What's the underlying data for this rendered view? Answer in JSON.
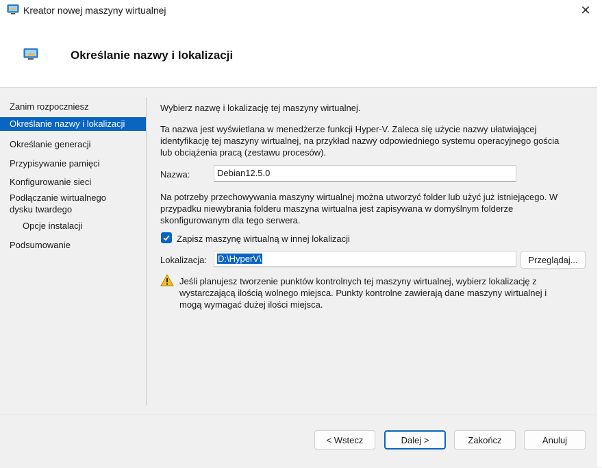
{
  "window": {
    "title": "Kreator nowej maszyny wirtualnej",
    "close_glyph": "✕"
  },
  "header": {
    "title": "Określanie nazwy i lokalizacji",
    "icon": "vm-monitor-icon"
  },
  "nav": {
    "items": [
      {
        "label": "Zanim rozpoczniesz"
      },
      {
        "label": "Określanie nazwy i lokalizacji"
      },
      {
        "label": "Określanie generacji"
      },
      {
        "label": "Przypisywanie pamięci"
      },
      {
        "label": "Konfigurowanie sieci"
      },
      {
        "label": "Podłączanie wirtualnego"
      },
      {
        "label": "dysku twardego"
      },
      {
        "label": "Opcje instalacji"
      },
      {
        "label": "Podsumowanie"
      }
    ]
  },
  "content": {
    "intro": "Wybierz nazwę i lokalizację tej maszyny wirtualnej.",
    "desc": [
      "Ta nazwa jest wyświetlana w menedżerze funkcji Hyper-V. Zaleca się użycie nazwy ułatwiającej",
      "identyfikację tej maszyny wirtualnej, na przykład nazwy odpowiedniego systemu operacyjnego gościa",
      "lub obciążenia pracą (zestawu procesów)."
    ],
    "name_label": "Nazwa:",
    "name_value": "Debian12.5.0",
    "folder_info": [
      "Na potrzeby przechowywania maszyny wirtualnej można utworzyć folder lub użyć już istniejącego. W",
      "przypadku niewybrania folderu maszyna wirtualna jest zapisywana w domyślnym folderze",
      "skonfigurowanym dla tego serwera."
    ],
    "checkbox_label": "Zapisz maszynę wirtualną w innej lokalizacji",
    "checkbox_checked": true,
    "location_label": "Lokalizacja:",
    "location_value": "D:\\HyperV\\",
    "browse_label": "Przeglądaj...",
    "warning": [
      "Jeśli planujesz tworzenie punktów kontrolnych tej maszyny wirtualnej, wybierz lokalizację z",
      "wystarczającą ilością wolnego miejsca. Punkty kontrolne zawierają dane maszyny wirtualnej i",
      "mogą wymagać dużej ilości miejsca."
    ]
  },
  "footer": {
    "back_label": "< Wstecz",
    "next_label": "Dalej >",
    "finish_label": "Zakończ",
    "cancel_label": "Anuluj"
  },
  "colors": {
    "accent": "#0a64c2",
    "panel": "#f0f0f0",
    "warning": "#e6a817"
  }
}
